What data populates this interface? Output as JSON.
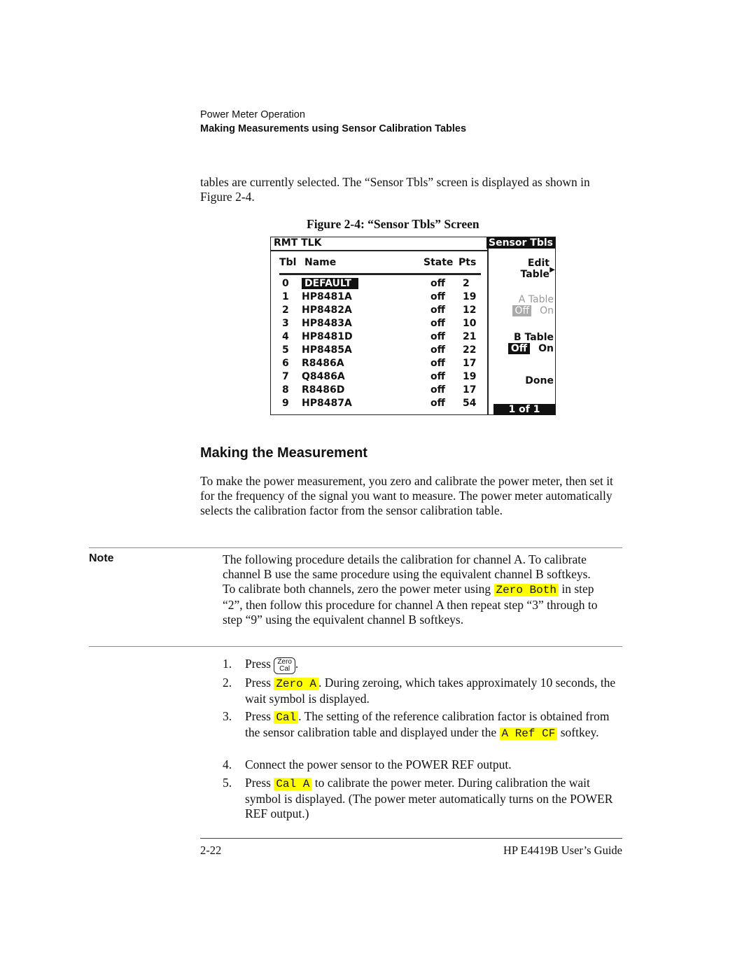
{
  "header": {
    "section": "Power Meter Operation",
    "subsection": "Making Measurements using Sensor Calibration Tables"
  },
  "intro": "tables are currently selected. The “Sensor Tbls” screen is displayed as shown in Figure 2-4.",
  "figure": {
    "caption": "Figure 2-4:  “Sensor Tbls” Screen",
    "status": "RMT TLK",
    "menu_title": "Sensor Tbls",
    "columns": [
      "Tbl",
      "Name",
      "State",
      "Pts"
    ],
    "rows": [
      {
        "tbl": "0",
        "name": "DEFAULT",
        "state": "off",
        "pts": "2"
      },
      {
        "tbl": "1",
        "name": "HP8481A",
        "state": "off",
        "pts": "19"
      },
      {
        "tbl": "2",
        "name": "HP8482A",
        "state": "off",
        "pts": "12"
      },
      {
        "tbl": "3",
        "name": "HP8483A",
        "state": "off",
        "pts": "10"
      },
      {
        "tbl": "4",
        "name": "HP8481D",
        "state": "off",
        "pts": "21"
      },
      {
        "tbl": "5",
        "name": "HP8485A",
        "state": "off",
        "pts": "22"
      },
      {
        "tbl": "6",
        "name": "R8486A",
        "state": "off",
        "pts": "17"
      },
      {
        "tbl": "7",
        "name": "Q8486A",
        "state": "off",
        "pts": "19"
      },
      {
        "tbl": "8",
        "name": "R8486D",
        "state": "off",
        "pts": "17"
      },
      {
        "tbl": "9",
        "name": "HP8487A",
        "state": "off",
        "pts": "54"
      }
    ],
    "softkeys": {
      "edit1": "Edit",
      "edit2": "Table",
      "a_table": "A Table",
      "a_off": "Off",
      "a_on": "On",
      "b_table": "B Table",
      "b_off": "Off",
      "b_on": "On",
      "done": "Done",
      "page": "1 of 1"
    }
  },
  "section_title": "Making the Measurement",
  "section_text": "To make the power measurement, you zero and calibrate the power meter, then set it for the frequency of the signal you want to measure. The power meter automatically selects the calibration factor from the sensor calibration table.",
  "note": {
    "label": "Note",
    "t1": "The following procedure details the calibration for channel A. To calibrate channel B use the same procedure using the equivalent channel B softkeys. To calibrate both channels, zero the power meter using ",
    "key": "Zero Both",
    "t2": " in step “2”, then follow this procedure for channel A then repeat step “3” through to step “9” using the equivalent channel B softkeys."
  },
  "steps": [
    {
      "n": "1.",
      "a": "Press ",
      "zc1": "Zero",
      "zc2": "Cal",
      "b": "."
    },
    {
      "n": "2.",
      "a": "Press ",
      "key": "Zero A",
      "b": ". During zeroing, which takes approximately 10 seconds, the wait symbol is displayed."
    },
    {
      "n": "3.",
      "a": "Press ",
      "key": "Cal",
      "b": ". The setting of the reference calibration factor is obtained from the sensor calibration table and displayed under the ",
      "key2": "A Ref CF",
      "c": " softkey."
    },
    {
      "n": "4.",
      "a": "Connect the power sensor to the POWER REF output."
    },
    {
      "n": "5.",
      "a": "Press ",
      "key": "Cal A",
      "b": " to calibrate the power meter. During calibration the wait symbol is displayed. (The power meter automatically turns on the POWER REF output.)"
    }
  ],
  "footer": {
    "page": "2-22",
    "guide": "HP E4419B User’s Guide"
  }
}
